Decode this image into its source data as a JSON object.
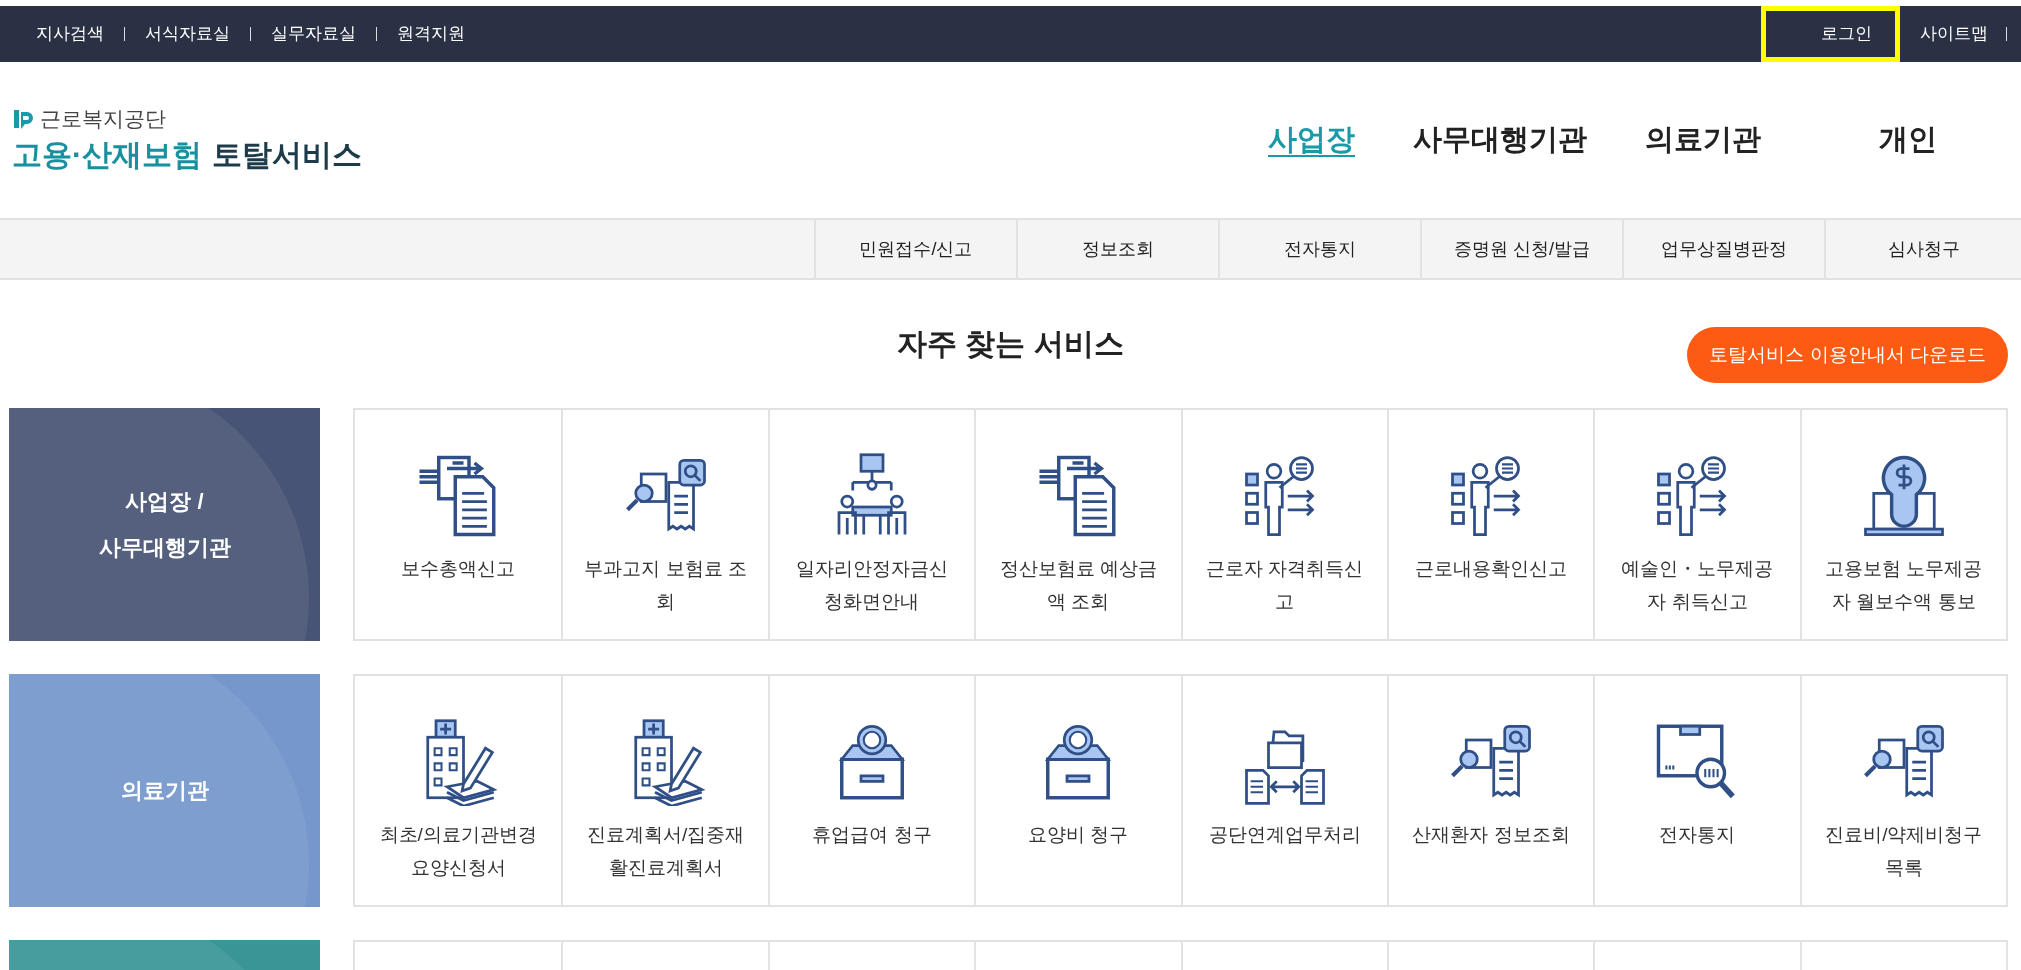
{
  "utility_links": {
    "left": [
      {
        "label": "지사검색"
      },
      {
        "label": "서식자료실"
      },
      {
        "label": "실무자료실"
      },
      {
        "label": "원격지원"
      }
    ],
    "right": [
      {
        "label": "로그인",
        "highlighted": true
      },
      {
        "label": "사이트맵",
        "highlighted": false
      }
    ]
  },
  "logo": {
    "agency": "근로복지공단",
    "title_colored": "고용·산재보험",
    "title": "토탈서비스"
  },
  "main_nav": [
    {
      "label": "사업장",
      "selected": true
    },
    {
      "label": "사무대행기관",
      "selected": false
    },
    {
      "label": "의료기관",
      "selected": false
    },
    {
      "label": "개인",
      "selected": false
    }
  ],
  "sub_nav": [
    "민원접수/신고",
    "정보조회",
    "전자통지",
    "증명원 신청/발급",
    "업무상질병판정",
    "심사청구"
  ],
  "services": {
    "title": "자주 찾는 서비스",
    "download_button": "토탈서비스 이용안내서 다운로드",
    "rows": [
      {
        "category": "사업장 /\n사무대행기관",
        "color": "#485475",
        "tiles": [
          "보수총액신고",
          "부과고지 보험료 조\n회",
          "일자리안정자금신\n청화면안내",
          "정산보험료 예상금\n액 조회",
          "근로자 자격취득신\n고",
          "근로내용확인신고",
          "예술인・노무제공\n자 취득신고",
          "고용보험 노무제공\n자 월보수액 통보"
        ]
      },
      {
        "category": "의료기관",
        "color": "#7597cc",
        "tiles": [
          "최초/의료기관변경\n요양신청서",
          "진료계획서/집중재\n활진료계획서",
          "휴업급여 청구",
          "요양비 청구",
          "공단연계업무처리",
          "산재환자 정보조회",
          "전자통지",
          "진료비/약제비청구\n목록"
        ]
      },
      {
        "color": "#3a9696"
      }
    ]
  }
}
